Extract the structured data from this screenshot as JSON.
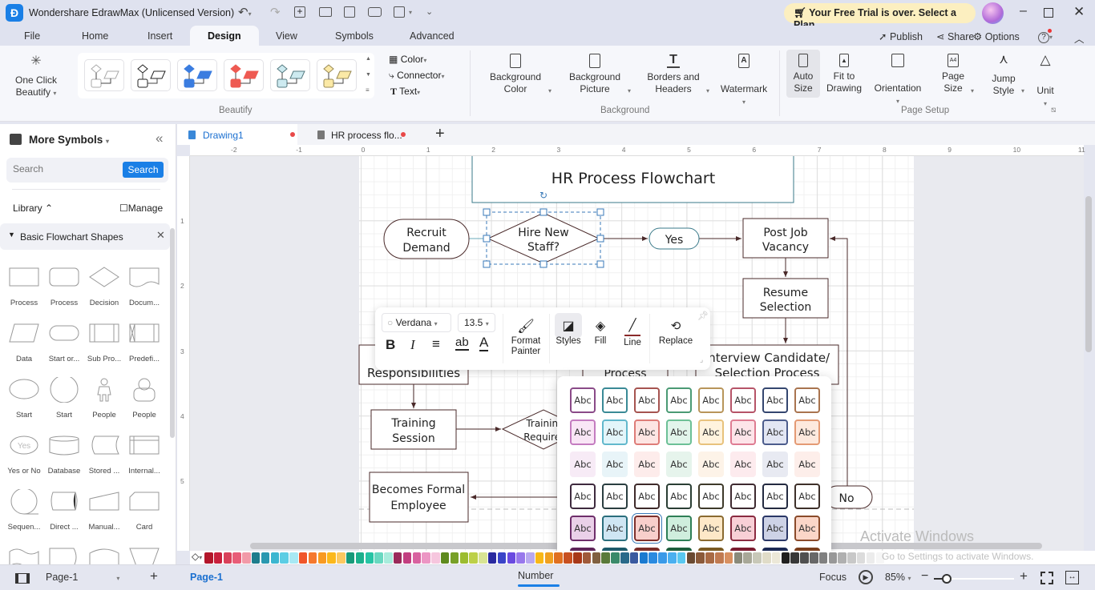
{
  "app": {
    "title": "Wondershare EdrawMax (Unlicensed Version)",
    "trial_banner": "Your Free Trial is over. Select a Plan",
    "accent": "#1a7fe6"
  },
  "menu": {
    "tabs": [
      "File",
      "Home",
      "Insert",
      "Design",
      "View",
      "Symbols",
      "Advanced"
    ],
    "active": "Design",
    "publish": "Publish",
    "share": "Share",
    "options": "Options"
  },
  "ribbon": {
    "beautify": {
      "one_click_1": "One Click",
      "one_click_2": "Beautify",
      "color": "Color",
      "connector": "Connector",
      "text": "Text",
      "group": "Beautify",
      "themes": [
        {
          "fill": "#ffffff",
          "stroke": "#aaaaaa"
        },
        {
          "fill": "#ffffff",
          "stroke": "#222222"
        },
        {
          "fill": "#3b7de0",
          "stroke": "#3b7de0"
        },
        {
          "fill": "#ee5a52",
          "stroke": "#ee5a52"
        },
        {
          "fill": "#cdeaf0",
          "stroke": "#557a80"
        },
        {
          "fill": "#fbe9a6",
          "stroke": "#998a55"
        }
      ]
    },
    "background": {
      "bg_color_1": "Background",
      "bg_color_2": "Color",
      "bg_picture_1": "Background",
      "bg_picture_2": "Picture",
      "borders_1": "Borders and",
      "borders_2": "Headers",
      "watermark": "Watermark",
      "group": "Background"
    },
    "page_setup": {
      "auto_size_1": "Auto",
      "auto_size_2": "Size",
      "fit_1": "Fit to",
      "fit_2": "Drawing",
      "orientation": "Orientation",
      "page_size_1": "Page",
      "page_size_2": "Size",
      "jump_1": "Jump",
      "jump_2": "Style",
      "unit": "Unit",
      "group": "Page Setup"
    }
  },
  "left_panel": {
    "title": "More Symbols",
    "search_placeholder": "Search",
    "search_button": "Search",
    "library": "Library",
    "manage": "Manage",
    "category": "Basic Flowchart Shapes",
    "shapes": [
      {
        "label": "Process",
        "shape": "rect"
      },
      {
        "label": "Process",
        "shape": "rounded-rect"
      },
      {
        "label": "Decision",
        "shape": "diamond"
      },
      {
        "label": "Docum...",
        "shape": "document"
      },
      {
        "label": "Data",
        "shape": "parallelogram"
      },
      {
        "label": "Start or...",
        "shape": "stadium"
      },
      {
        "label": "Sub Pro...",
        "shape": "subprocess"
      },
      {
        "label": "Predefi...",
        "shape": "predefined"
      },
      {
        "label": "Start",
        "shape": "ellipse"
      },
      {
        "label": "Start",
        "shape": "circle"
      },
      {
        "label": "People",
        "shape": "person"
      },
      {
        "label": "People",
        "shape": "user"
      },
      {
        "label": "Yes or No",
        "shape": "yes-ellipse"
      },
      {
        "label": "Database",
        "shape": "cylinder"
      },
      {
        "label": "Stored ...",
        "shape": "stored-data"
      },
      {
        "label": "Internal...",
        "shape": "internal-storage"
      },
      {
        "label": "Sequen...",
        "shape": "sequential"
      },
      {
        "label": "Direct ...",
        "shape": "direct-data"
      },
      {
        "label": "Manual...",
        "shape": "manual-input"
      },
      {
        "label": "Card",
        "shape": "card"
      },
      {
        "label": "",
        "shape": "tape"
      },
      {
        "label": "",
        "shape": "display"
      },
      {
        "label": "",
        "shape": "off-page"
      },
      {
        "label": "",
        "shape": "trapezoid"
      }
    ],
    "yes_glyph": "Yes"
  },
  "doc_tabs": [
    {
      "label": "Drawing1",
      "active": true,
      "unsaved": true
    },
    {
      "label": "HR process flo...",
      "active": false,
      "unsaved": true
    }
  ],
  "rulers": {
    "h": [
      "-2",
      "-1",
      "0",
      "1",
      "2",
      "3",
      "4",
      "5",
      "6",
      "7",
      "8",
      "9",
      "10",
      "11"
    ],
    "v": [
      "1",
      "2",
      "3",
      "4",
      "5"
    ]
  },
  "diagram": {
    "title": "HR Process Flowchart",
    "recruit": [
      "Recruit",
      "Demand"
    ],
    "hire": [
      "Hire New",
      "Staff?"
    ],
    "yes": "Yes",
    "post": [
      "Post Job",
      "Vacancy"
    ],
    "resume": [
      "Resume",
      "Selection"
    ],
    "interview": [
      "Interview Candidate/",
      "Selection Process"
    ],
    "process": "Process",
    "responsibilities": "Responsibilities",
    "training": [
      "Training",
      "Session"
    ],
    "training_req": [
      "Training",
      "Required"
    ],
    "becomes": [
      "Becomes Formal",
      "Employee"
    ],
    "no": "No"
  },
  "floating_toolbar": {
    "font": "Verdana",
    "size": "13.5",
    "format_painter_1": "Format",
    "format_painter_2": "Painter",
    "styles": "Styles",
    "fill": "Fill",
    "line": "Line",
    "replace": "Replace"
  },
  "styles_popup": {
    "label": "Abc",
    "selected": [
      4,
      2
    ],
    "rows": [
      {
        "bg": [
          "#fff",
          "#fff",
          "#fff",
          "#fff",
          "#fff",
          "#fff",
          "#fff",
          "#fff"
        ],
        "border": [
          "#8a4a88",
          "#3a8a96",
          "#a65450",
          "#4a9a74",
          "#b8955a",
          "#b65468",
          "#34466f",
          "#a9744f"
        ],
        "text": "#333"
      },
      {
        "bg": [
          "#f9e6f6",
          "#e3f5fa",
          "#fde5e3",
          "#e2f5eb",
          "#fff3de",
          "#fde4e9",
          "#e2e6f3",
          "#fde9de"
        ],
        "border": [
          "#c47cc0",
          "#62b8cc",
          "#de7c78",
          "#6cc096",
          "#e8c27c",
          "#de7c92",
          "#4c5c8c",
          "#e49a74"
        ],
        "text": "#333"
      },
      {
        "bg": [
          "#f7ebf6",
          "#e8f4f8",
          "#fdeceb",
          "#e6f4ec",
          "#fdf3e8",
          "#fdebee",
          "#e8eaf2",
          "#fdeeea"
        ],
        "border": [
          "#f7ebf6",
          "#e8f4f8",
          "#fdeceb",
          "#e6f4ec",
          "#fdf3e8",
          "#fdebee",
          "#e8eaf2",
          "#fdeeea"
        ],
        "text": "#333"
      },
      {
        "bg": [
          "#fff",
          "#fff",
          "#fff",
          "#fff",
          "#fff",
          "#fff",
          "#fff",
          "#fff"
        ],
        "border": [
          "#3e2a3e",
          "#2a3e40",
          "#3e2a2a",
          "#2a3e34",
          "#3e3a2a",
          "#3e2a30",
          "#232a40",
          "#3e302a"
        ],
        "text": "#333"
      },
      {
        "bg": [
          "#ead0e8",
          "#cfe6f3",
          "#f8cfcb",
          "#cfeedd",
          "#fde8c8",
          "#f8cfd6",
          "#cdd2e6",
          "#fbd6c8"
        ],
        "border": [
          "#6e2e6a",
          "#2a6e7c",
          "#7e302c",
          "#2e7e56",
          "#8a6a30",
          "#8a2a40",
          "#2a3766",
          "#8a4a2a"
        ],
        "text": "#333"
      },
      {
        "bg": [
          "#5e2558",
          "#1c5a6a",
          "#772e2a",
          "#1d5e3c",
          "#7a5a22",
          "#7a1c30",
          "#1c2a55",
          "#7a3e1c"
        ],
        "border": [
          "#5e2558",
          "#1c5a6a",
          "#772e2a",
          "#1d5e3c",
          "#7a5a22",
          "#7a1c30",
          "#1c2a55",
          "#7a3e1c"
        ],
        "text": "#fff"
      }
    ]
  },
  "palette": [
    "#b3162a",
    "#c8203c",
    "#d9415a",
    "#e85d78",
    "#f29aa8",
    "#1e7d8c",
    "#2a98b0",
    "#3cb6d0",
    "#5ccde4",
    "#a8e8f4",
    "#f0552a",
    "#f5782e",
    "#f89a22",
    "#fbb81c",
    "#fcc860",
    "#179a7a",
    "#1cb08c",
    "#26c4a4",
    "#68d8c0",
    "#a8ecdc",
    "#9a2a5a",
    "#c23e80",
    "#d862a0",
    "#ec96c4",
    "#f6c6de",
    "#5e8a1e",
    "#78a028",
    "#9cbc30",
    "#bcd048",
    "#d8e494",
    "#2a2aa0",
    "#3a44c8",
    "#6a4ae0",
    "#9878ec",
    "#b8a8f0",
    "#f8b818",
    "#f0a020",
    "#e07020",
    "#c85020",
    "#a83818",
    "#a05a3a",
    "#806040",
    "#5a7a3a",
    "#3a8a6a",
    "#2a6a8a",
    "#3a5aa0",
    "#1a7ad0",
    "#2a8ae0",
    "#3a9ae8",
    "#4ab0f0",
    "#5ac8f0",
    "#6a4a32",
    "#8a5a3a",
    "#a86a44",
    "#c07a50",
    "#d89060",
    "#8a8a7a",
    "#a8a898",
    "#c8c8b8",
    "#e0dcc8",
    "#ece8d8",
    "#202020",
    "#383838",
    "#505050",
    "#686868",
    "#808080",
    "#989898",
    "#b0b0b0",
    "#c8c8c8",
    "#dcdcdc",
    "#ececec",
    "#f6f6f6"
  ],
  "watermark": {
    "line1": "Activate Windows",
    "line2": "Go to Settings to activate Windows."
  },
  "status": {
    "page_select": "Page-1",
    "page_tab": "Page-1",
    "number": "Number",
    "focus": "Focus",
    "zoom": "85%",
    "zoom_level": 85
  }
}
